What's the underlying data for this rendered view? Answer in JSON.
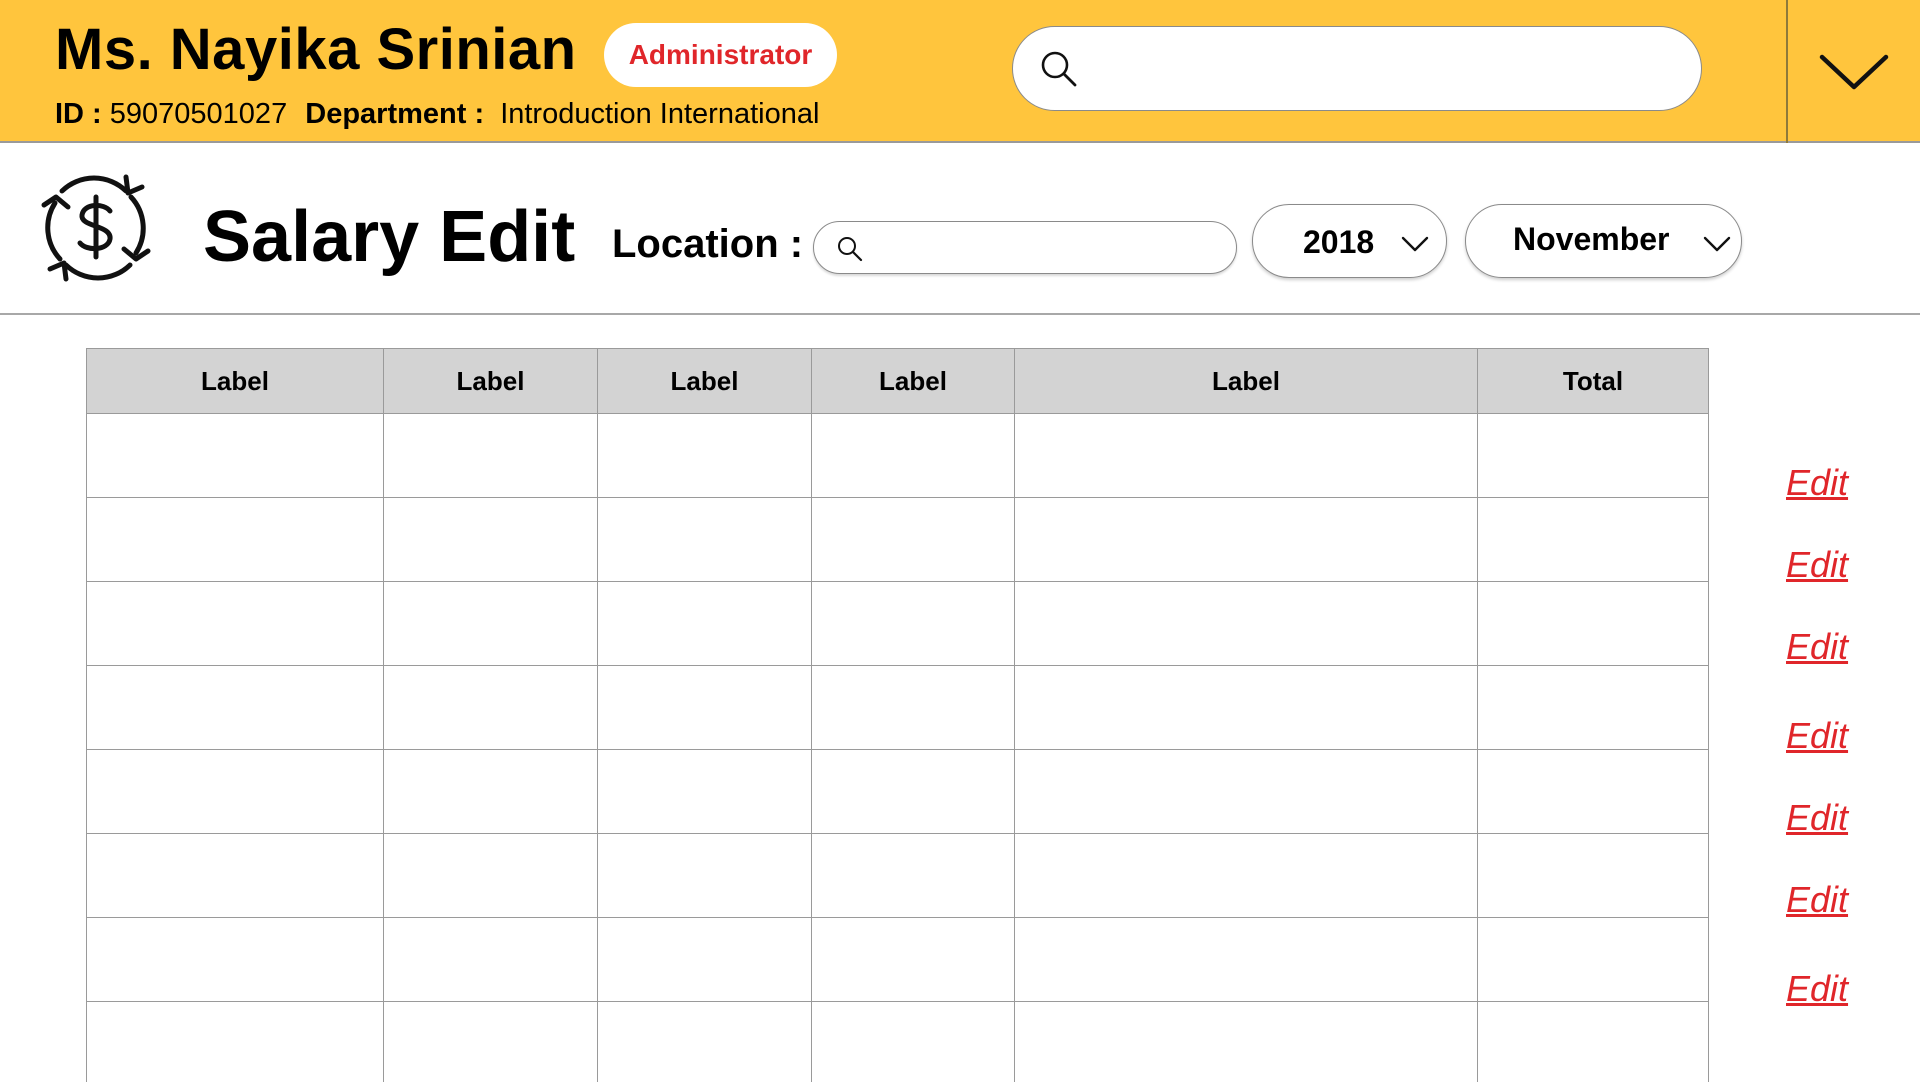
{
  "header": {
    "user_name": "Ms. Nayika Srinian",
    "role_badge": "Administrator",
    "id_label": "ID :",
    "id_value": "59070501027",
    "department_label": "Department :",
    "department_value": "Introduction International",
    "search_placeholder": "",
    "menu_icon": "chevron-down-icon"
  },
  "page": {
    "title": "Salary Edit",
    "icon": "currency-exchange-icon",
    "location_label": "Location :",
    "location_placeholder": "",
    "year": "2018",
    "month": "November"
  },
  "table": {
    "columns": [
      "Label",
      "Label",
      "Label",
      "Label",
      "Label",
      "Total"
    ],
    "rows": [
      [
        "",
        "",
        "",
        "",
        "",
        ""
      ],
      [
        "",
        "",
        "",
        "",
        "",
        ""
      ],
      [
        "",
        "",
        "",
        "",
        "",
        ""
      ],
      [
        "",
        "",
        "",
        "",
        "",
        ""
      ],
      [
        "",
        "",
        "",
        "",
        "",
        ""
      ],
      [
        "",
        "",
        "",
        "",
        "",
        ""
      ],
      [
        "",
        "",
        "",
        "",
        "",
        ""
      ],
      [
        "",
        "",
        "",
        "",
        "",
        ""
      ]
    ]
  },
  "actions": {
    "edit_labels": [
      "Edit",
      "Edit",
      "Edit",
      "Edit",
      "Edit",
      "Edit",
      "Edit"
    ]
  },
  "colors": {
    "header_bg": "#FFC53D",
    "accent_red": "#E0262A",
    "table_header_bg": "#D3D3D3"
  }
}
